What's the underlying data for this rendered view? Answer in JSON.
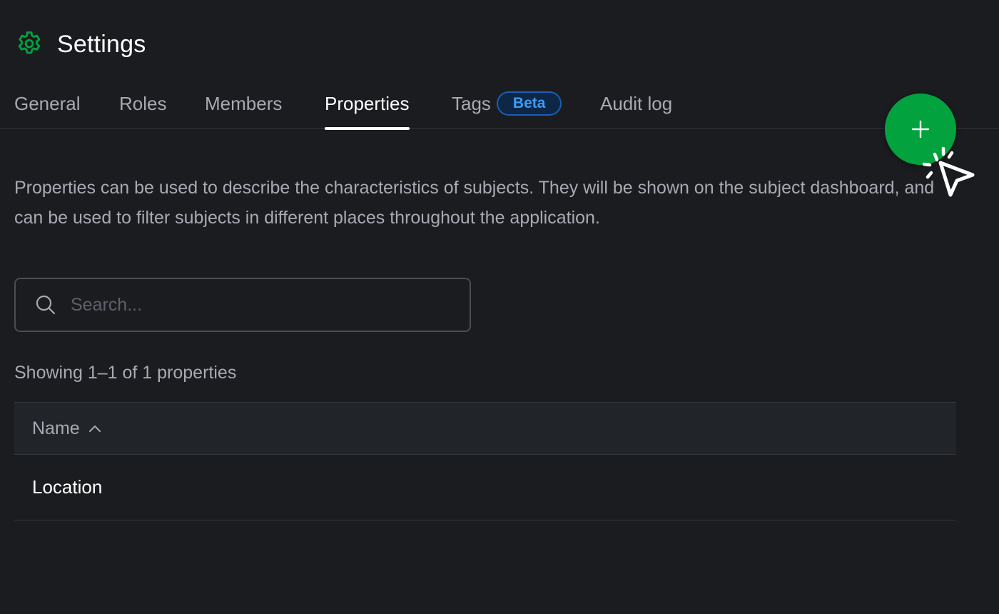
{
  "header": {
    "title": "Settings",
    "icon": "gear-icon",
    "icon_color": "#02a33f"
  },
  "tabs": [
    {
      "label": "General",
      "active": false
    },
    {
      "label": "Roles",
      "active": false
    },
    {
      "label": "Members",
      "active": false
    },
    {
      "label": "Properties",
      "active": true
    },
    {
      "label": "Tags",
      "active": false,
      "badge": "Beta"
    },
    {
      "label": "Audit log",
      "active": false
    }
  ],
  "fab": {
    "icon": "plus-icon",
    "color": "#02a33f"
  },
  "description": "Properties can be used to describe the characteristics of subjects. They will be shown on the subject dashboard, and can be used to filter subjects in different places throughout the application.",
  "search": {
    "placeholder": "Search...",
    "value": ""
  },
  "results_summary": "Showing 1–1 of 1 properties",
  "table": {
    "columns": [
      {
        "label": "Name",
        "sort": "ascending"
      }
    ],
    "rows": [
      {
        "name": "Location"
      }
    ]
  },
  "colors": {
    "background": "#1b1c20",
    "accent": "#02a33f",
    "badge_text": "#3d9bf5"
  }
}
